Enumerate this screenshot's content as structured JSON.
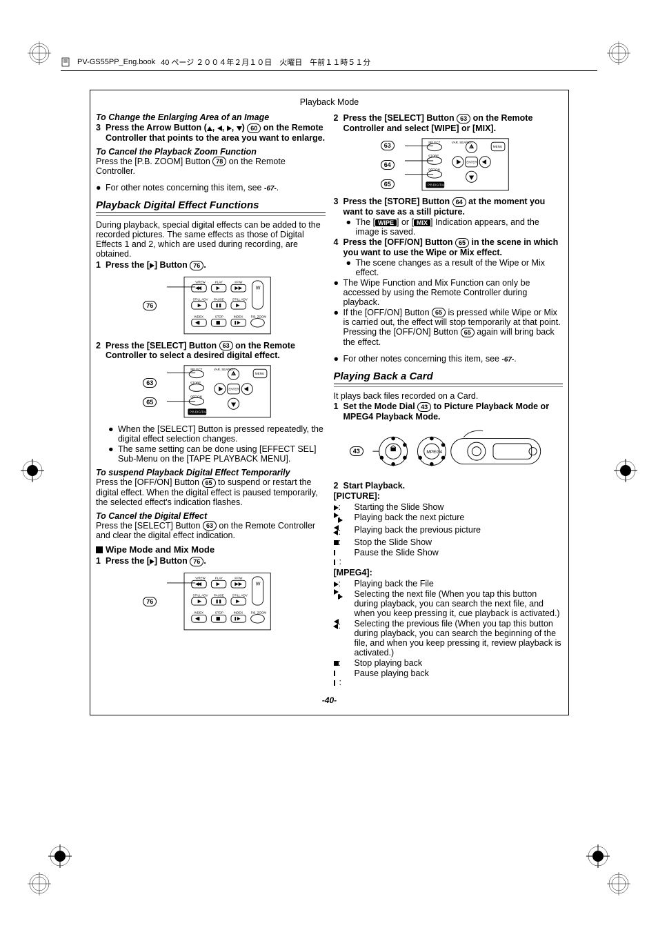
{
  "header": {
    "book": "PV-GS55PP_Eng.book",
    "page_text": "40 ページ ２００４年２月１０日　火曜日　午前１１時５１分"
  },
  "section_header": "Playback Mode",
  "left": {
    "h_change": "To Change the Enlarging Area of an Image",
    "step3": "Press the Arrow Button (",
    "step3_end": ") ",
    "step3_ref": "60",
    "step3_cont": " on the Remote Controller that points to the area you want to enlarge.",
    "h_cancel_zoom": "To Cancel the Playback Zoom Function",
    "cancel_zoom_text": "Press the [P.B. ZOOM] Button ",
    "cancel_zoom_ref": "78",
    "cancel_zoom_end": " on the Remote Controller.",
    "notes1": "For other notes concerning this item, see ",
    "notes1_ref": "-67-",
    "h2_effects": "Playback Digital Effect Functions",
    "effects_intro": "During playback, special digital effects can be added to the recorded pictures. The same effects as those of Digital Effects 1 and 2, which are used during recording, are obtained.",
    "step1_eff": "Press the [",
    "step1_eff_end": "] Button ",
    "step1_eff_ref": "76",
    "fig1_callout": "76",
    "step2_eff": "Press the [SELECT] Button ",
    "step2_eff_ref": "63",
    "step2_eff_end": " on the Remote Controller to select a desired digital effect.",
    "fig2_callouts": [
      "63",
      "65"
    ],
    "bul1": "When the [SELECT] Button is pressed repeatedly, the digital effect selection changes.",
    "bul2": "The same setting can be done using [EFFECT SEL] Sub-Menu on the [TAPE PLAYBACK MENU].",
    "h_suspend": "To suspend Playback Digital Effect Temporarily",
    "suspend_text1": "Press the [OFF/ON] Button ",
    "suspend_ref": "65",
    "suspend_text2": " to suspend or restart the digital effect. When the digital effect is paused temporarily, the selected effect's indication flashes.",
    "h_cancel_eff": "To Cancel the Digital Effect",
    "cancel_eff_text1": "Press the [SELECT] Button ",
    "cancel_eff_ref": "63",
    "cancel_eff_text2": " on the Remote Controller and clear the digital effect indication.",
    "h_wipe": "Wipe Mode and Mix Mode",
    "wipe_step1": "Press the [",
    "wipe_step1_end": "] Button ",
    "wipe_step1_ref": "76",
    "fig3_callout": "76"
  },
  "right": {
    "step2": "Press the [SELECT] Button ",
    "step2_ref": "63",
    "step2_end": " on the Remote Controller and select [WIPE] or [MIX].",
    "figR_callouts": [
      "63",
      "64",
      "65"
    ],
    "step3": "Press the [STORE] Button ",
    "step3_ref": "64",
    "step3_end": " at the moment you want to save as a still picture.",
    "step3_b1a": "The [",
    "pill_wipe": "WIPE",
    "step3_b1b": "] or [",
    "pill_mix": "MIX",
    "step3_b1c": "] Indication appears, and the image is saved.",
    "step4": "Press the [OFF/ON] Button ",
    "step4_ref": "65",
    "step4_end": " in the scene in which you want to use the Wipe or Mix effect.",
    "step4_b1": "The scene changes as a result of the Wipe or Mix effect.",
    "bulA": "The Wipe Function and Mix Function can only be accessed by using the Remote Controller during playback.",
    "bulB1": "If the [OFF/ON] Button ",
    "bulB_ref": "65",
    "bulB2": " is pressed while Wipe or Mix is carried out, the effect will stop temporarily at that point. Pressing the [OFF/ON] Button ",
    "bulB_ref2": "65",
    "bulB3": " again will bring back the effect.",
    "notes2": "For other notes concerning this item, see ",
    "notes2_ref": "-67-",
    "h2_card": "Playing Back a Card",
    "card_intro": "It plays back files recorded on a Card.",
    "card_step1a": "Set the Mode Dial ",
    "card_step1_ref": "43",
    "card_step1b": " to Picture Playback Mode or MPEG4 Playback Mode.",
    "figCam_callout": "43",
    "card_step2": "Start Playback.",
    "picture_h": "[PICTURE]:",
    "pic_rows": [
      "Starting the Slide Show",
      "Playing back the next picture",
      "Playing back the previous picture",
      "Stop the Slide Show",
      "Pause the Slide Show"
    ],
    "mpeg_h": "[MPEG4]:",
    "mpeg_rows": [
      "Playing back the File",
      "Selecting the next file (When you tap this button during playback, you can search the next file, and when you keep pressing it, cue playback is activated.)",
      "Selecting the previous file (When you tap this button during playback, you can search the beginning of the file, and when you keep pressing it, review playback is activated.)",
      "Stop playing back",
      "Pause playing back"
    ]
  },
  "page_num": "-40-",
  "remote_labels": {
    "row1": [
      "V/REW",
      "PLAY",
      "FF/W"
    ],
    "row2": [
      "STILL ADV",
      "PAUSE",
      "STILL ADV"
    ],
    "row3": [
      "INDEX",
      "STOP",
      "INDEX"
    ],
    "pb": "P.B. ZOOM",
    "w": "W"
  },
  "remote2_labels": {
    "select": "SELECT",
    "var": "VAR. SEARCH",
    "store": "STORE",
    "offon": "OFF/ON",
    "pbd": "P.B.DIGITAL",
    "menu": "MENU",
    "enter": "ENTER",
    "a": "A"
  }
}
